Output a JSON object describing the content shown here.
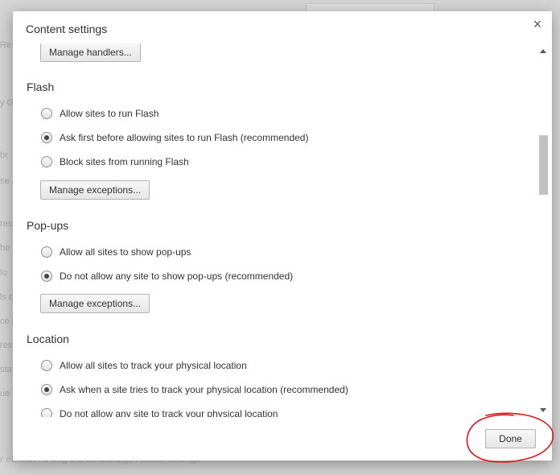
{
  "background": {
    "fragments": [
      "Re",
      "y G",
      "br",
      "se",
      "res",
      "he",
      "lo",
      "ls c",
      "ce f",
      "res",
      "sta",
      "ue"
    ],
    "footer_text": "r ebuMh i u oog b a uit Manage Autofill settings"
  },
  "dialog": {
    "title": "Content settings",
    "close_icon": "×",
    "manage_handlers_label": "Manage handlers...",
    "sections": {
      "flash": {
        "title": "Flash",
        "options": [
          {
            "label": "Allow sites to run Flash",
            "checked": false
          },
          {
            "label": "Ask first before allowing sites to run Flash (recommended)",
            "checked": true
          },
          {
            "label": "Block sites from running Flash",
            "checked": false
          }
        ],
        "exceptions_label": "Manage exceptions..."
      },
      "popups": {
        "title": "Pop-ups",
        "options": [
          {
            "label": "Allow all sites to show pop-ups",
            "checked": false
          },
          {
            "label": "Do not allow any site to show pop-ups (recommended)",
            "checked": true
          }
        ],
        "exceptions_label": "Manage exceptions..."
      },
      "location": {
        "title": "Location",
        "options": [
          {
            "label": "Allow all sites to track your physical location",
            "checked": false
          },
          {
            "label": "Ask when a site tries to track your physical location (recommended)",
            "checked": true
          },
          {
            "label": "Do not allow any site to track your physical location",
            "checked": false
          }
        ]
      }
    },
    "done_label": "Done"
  },
  "colors": {
    "annotation": "#e3131b",
    "overlay": "#d4d4d4"
  }
}
